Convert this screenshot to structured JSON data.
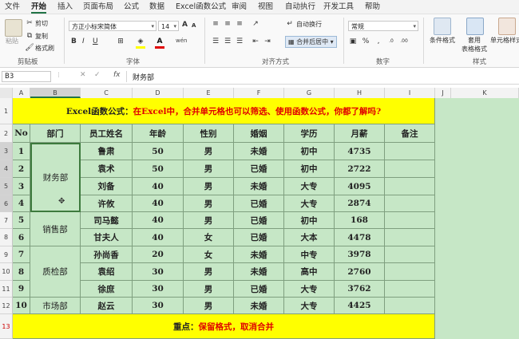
{
  "menu": [
    "文件",
    "开始",
    "插入",
    "页面布局",
    "公式",
    "数据",
    "Excel函数公式",
    "审阅",
    "视图",
    "自动执行",
    "开发工具",
    "帮助"
  ],
  "ribbon": {
    "clipboard": {
      "paste": "粘贴",
      "cut": "剪切",
      "copy": "复制",
      "format_painter": "格式刷",
      "label": "剪贴板"
    },
    "font": {
      "name": "方正小标宋简体",
      "size": "14",
      "bold": "B",
      "italic": "I",
      "underline": "U",
      "grow": "A",
      "shrink": "A",
      "label": "字体",
      "phonetic": "wén"
    },
    "alignment": {
      "wrap": "自动换行",
      "merge": "合并后居中",
      "label": "对齐方式"
    },
    "number": {
      "format": "常规",
      "label": "数字"
    },
    "styles": {
      "conditional": "条件格式",
      "table_format_1": "套用",
      "table_format_2": "表格格式",
      "cell_styles": "单元格样式",
      "label": "样式"
    }
  },
  "formula_bar": {
    "name_box": "B3",
    "fx": "fx",
    "content": "财务部"
  },
  "columns": [
    "A",
    "B",
    "C",
    "D",
    "E",
    "F",
    "G",
    "H",
    "I",
    "J",
    "K"
  ],
  "rows": [
    "1",
    "2",
    "3",
    "4",
    "5",
    "6",
    "7",
    "8",
    "9",
    "10",
    "11",
    "12",
    "13"
  ],
  "sheet": {
    "title_black": "Excel函数公式：",
    "title_red": "在Excel中，合并单元格也可以筛选、使用函数公式，你都了解吗?",
    "headers": [
      "No",
      "部门",
      "员工姓名",
      "年龄",
      "性别",
      "婚姻",
      "学历",
      "月薪",
      "备注"
    ],
    "records": [
      {
        "no": "1",
        "name": "鲁肃",
        "age": "50",
        "gender": "男",
        "marital": "未婚",
        "edu": "初中",
        "salary": "4735"
      },
      {
        "no": "2",
        "name": "袁术",
        "age": "50",
        "gender": "男",
        "marital": "已婚",
        "edu": "初中",
        "salary": "2722"
      },
      {
        "no": "3",
        "name": "刘备",
        "age": "40",
        "gender": "男",
        "marital": "未婚",
        "edu": "大专",
        "salary": "4095"
      },
      {
        "no": "4",
        "name": "许攸",
        "age": "40",
        "gender": "男",
        "marital": "已婚",
        "edu": "大专",
        "salary": "2874"
      },
      {
        "no": "5",
        "name": "司马懿",
        "age": "40",
        "gender": "男",
        "marital": "已婚",
        "edu": "初中",
        "salary": "168"
      },
      {
        "no": "6",
        "name": "甘夫人",
        "age": "40",
        "gender": "女",
        "marital": "已婚",
        "edu": "大本",
        "salary": "4478"
      },
      {
        "no": "7",
        "name": "孙尚香",
        "age": "20",
        "gender": "女",
        "marital": "未婚",
        "edu": "中专",
        "salary": "3978"
      },
      {
        "no": "8",
        "name": "袁绍",
        "age": "30",
        "gender": "男",
        "marital": "未婚",
        "edu": "高中",
        "salary": "2760"
      },
      {
        "no": "9",
        "name": "徐庶",
        "age": "30",
        "gender": "男",
        "marital": "已婚",
        "edu": "大专",
        "salary": "3762"
      },
      {
        "no": "10",
        "name": "赵云",
        "age": "30",
        "gender": "男",
        "marital": "未婚",
        "edu": "大专",
        "salary": "4425"
      }
    ],
    "departments": [
      "财务部",
      "销售部",
      "质检部",
      "市场部"
    ],
    "footer_black": "重点：",
    "footer_red": "保留格式，取消合并"
  }
}
